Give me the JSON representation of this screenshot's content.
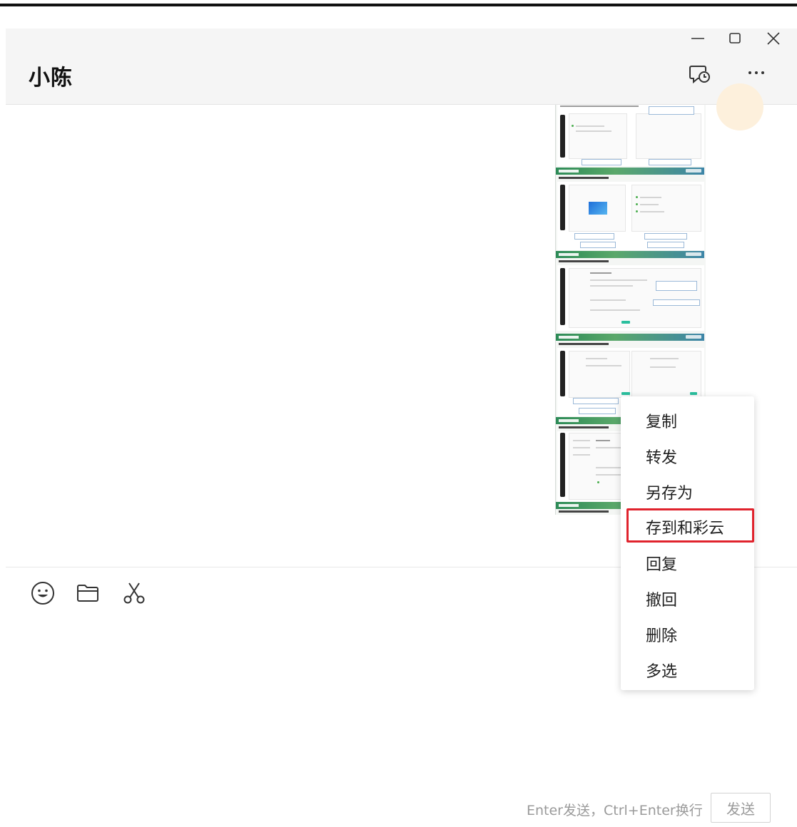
{
  "header": {
    "title": "小陈",
    "history_icon": "chat-history-icon",
    "more_icon": "more-icon"
  },
  "window_controls": {
    "minimize_icon": "minimize-icon",
    "maximize_icon": "maximize-icon",
    "close_icon": "close-icon"
  },
  "message": {
    "type": "image",
    "icon": "image-thumbnail"
  },
  "context_menu": {
    "items": [
      "复制",
      "转发",
      "另存为",
      "存到和彩云",
      "回复",
      "撤回",
      "删除",
      "多选"
    ],
    "highlighted": "存到和彩云",
    "highlight_color": "#e0232d"
  },
  "toolbar": {
    "emoji_icon": "emoji-icon",
    "folder_icon": "folder-icon",
    "scissors_icon": "scissors-icon"
  },
  "footer": {
    "hint": "Enter发送，Ctrl+Enter换行",
    "send_label": "发送"
  }
}
